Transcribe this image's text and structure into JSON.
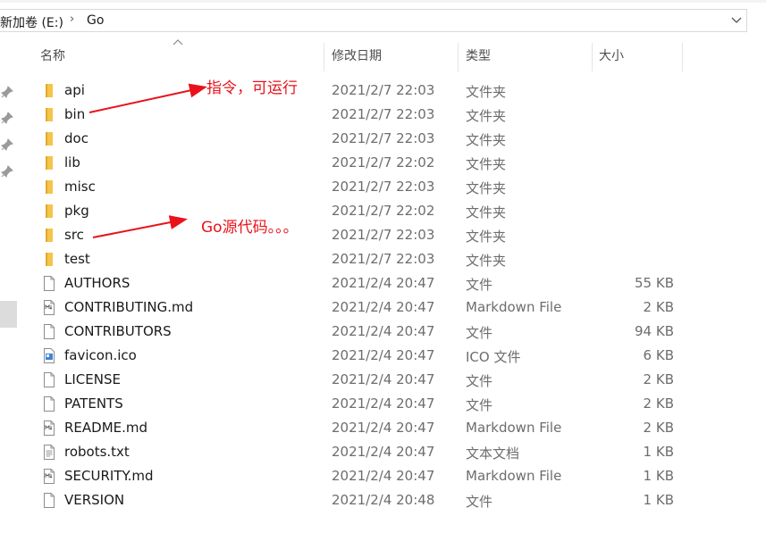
{
  "address": {
    "drive": "新加卷 (E:)",
    "folder": "Go",
    "separator": "›"
  },
  "columns": {
    "name": "名称",
    "modified": "修改日期",
    "type": "类型",
    "size": "大小"
  },
  "files": [
    {
      "icon": "folder-icon",
      "name": "api",
      "modified": "2021/2/7 22:03",
      "type": "文件夹",
      "size": ""
    },
    {
      "icon": "folder-icon",
      "name": "bin",
      "modified": "2021/2/7 22:03",
      "type": "文件夹",
      "size": ""
    },
    {
      "icon": "folder-icon",
      "name": "doc",
      "modified": "2021/2/7 22:03",
      "type": "文件夹",
      "size": ""
    },
    {
      "icon": "folder-icon",
      "name": "lib",
      "modified": "2021/2/7 22:02",
      "type": "文件夹",
      "size": ""
    },
    {
      "icon": "folder-icon",
      "name": "misc",
      "modified": "2021/2/7 22:03",
      "type": "文件夹",
      "size": ""
    },
    {
      "icon": "folder-icon",
      "name": "pkg",
      "modified": "2021/2/7 22:02",
      "type": "文件夹",
      "size": ""
    },
    {
      "icon": "folder-icon",
      "name": "src",
      "modified": "2021/2/7 22:03",
      "type": "文件夹",
      "size": ""
    },
    {
      "icon": "folder-icon",
      "name": "test",
      "modified": "2021/2/7 22:03",
      "type": "文件夹",
      "size": ""
    },
    {
      "icon": "file-icon",
      "name": "AUTHORS",
      "modified": "2021/2/4 20:47",
      "type": "文件",
      "size": "55 KB"
    },
    {
      "icon": "markdown-file-icon",
      "name": "CONTRIBUTING.md",
      "modified": "2021/2/4 20:47",
      "type": "Markdown File",
      "size": "2 KB"
    },
    {
      "icon": "file-icon",
      "name": "CONTRIBUTORS",
      "modified": "2021/2/4 20:47",
      "type": "文件",
      "size": "94 KB"
    },
    {
      "icon": "image-file-icon",
      "name": "favicon.ico",
      "modified": "2021/2/4 20:47",
      "type": "ICO 文件",
      "size": "6 KB"
    },
    {
      "icon": "file-icon",
      "name": "LICENSE",
      "modified": "2021/2/4 20:47",
      "type": "文件",
      "size": "2 KB"
    },
    {
      "icon": "file-icon",
      "name": "PATENTS",
      "modified": "2021/2/4 20:47",
      "type": "文件",
      "size": "2 KB"
    },
    {
      "icon": "markdown-file-icon",
      "name": "README.md",
      "modified": "2021/2/4 20:47",
      "type": "Markdown File",
      "size": "2 KB"
    },
    {
      "icon": "text-file-icon",
      "name": "robots.txt",
      "modified": "2021/2/4 20:47",
      "type": "文本文档",
      "size": "1 KB"
    },
    {
      "icon": "markdown-file-icon",
      "name": "SECURITY.md",
      "modified": "2021/2/4 20:47",
      "type": "Markdown File",
      "size": "1 KB"
    },
    {
      "icon": "file-icon",
      "name": "VERSION",
      "modified": "2021/2/4 20:48",
      "type": "文件",
      "size": "1 KB"
    }
  ],
  "annotations": {
    "bin_note": "指令，可运行",
    "src_note": "Go源代码。。。"
  },
  "colors": {
    "annotation": "#e8131a",
    "folder": "#f4c54a",
    "header_text": "#4d4d4d",
    "secondary_text": "#6d6d6d"
  }
}
